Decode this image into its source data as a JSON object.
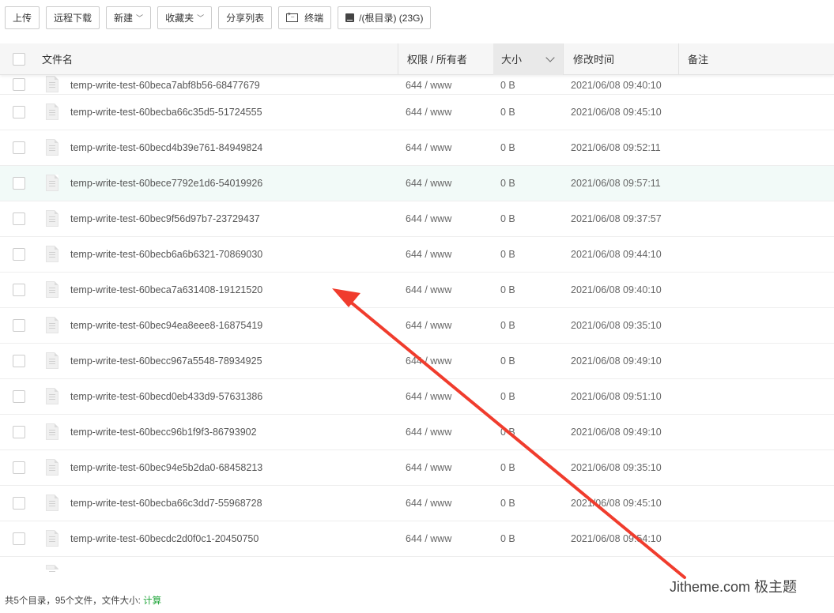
{
  "toolbar": {
    "upload": "上传",
    "remote_download": "远程下载",
    "new": "新建",
    "favorites": "收藏夹",
    "share_list": "分享列表",
    "terminal": "终端",
    "disk": "/(根目录) (23G)"
  },
  "table": {
    "headers": {
      "name": "文件名",
      "perm": "权限 / 所有者",
      "size": "大小",
      "mtime": "修改时间",
      "note": "备注"
    },
    "partial_row": {
      "name": "temp-write-test-60beca7abf8b56-68477679",
      "perm": "644 / www",
      "size": "0 B",
      "mtime": "2021/06/08 09:40:10"
    },
    "rows": [
      {
        "name": "temp-write-test-60becba66c35d5-51724555",
        "perm": "644 / www",
        "size": "0 B",
        "mtime": "2021/06/08 09:45:10"
      },
      {
        "name": "temp-write-test-60becd4b39e761-84949824",
        "perm": "644 / www",
        "size": "0 B",
        "mtime": "2021/06/08 09:52:11"
      },
      {
        "name": "temp-write-test-60bece7792e1d6-54019926",
        "perm": "644 / www",
        "size": "0 B",
        "mtime": "2021/06/08 09:57:11"
      },
      {
        "name": "temp-write-test-60bec9f56d97b7-23729437",
        "perm": "644 / www",
        "size": "0 B",
        "mtime": "2021/06/08 09:37:57"
      },
      {
        "name": "temp-write-test-60becb6a6b6321-70869030",
        "perm": "644 / www",
        "size": "0 B",
        "mtime": "2021/06/08 09:44:10"
      },
      {
        "name": "temp-write-test-60beca7a631408-19121520",
        "perm": "644 / www",
        "size": "0 B",
        "mtime": "2021/06/08 09:40:10"
      },
      {
        "name": "temp-write-test-60bec94ea8eee8-16875419",
        "perm": "644 / www",
        "size": "0 B",
        "mtime": "2021/06/08 09:35:10"
      },
      {
        "name": "temp-write-test-60becc967a5548-78934925",
        "perm": "644 / www",
        "size": "0 B",
        "mtime": "2021/06/08 09:49:10"
      },
      {
        "name": "temp-write-test-60becd0eb433d9-57631386",
        "perm": "644 / www",
        "size": "0 B",
        "mtime": "2021/06/08 09:51:10"
      },
      {
        "name": "temp-write-test-60becc96b1f9f3-86793902",
        "perm": "644 / www",
        "size": "0 B",
        "mtime": "2021/06/08 09:49:10"
      },
      {
        "name": "temp-write-test-60bec94e5b2da0-68458213",
        "perm": "644 / www",
        "size": "0 B",
        "mtime": "2021/06/08 09:35:10"
      },
      {
        "name": "temp-write-test-60becba66c3dd7-55968728",
        "perm": "644 / www",
        "size": "0 B",
        "mtime": "2021/06/08 09:45:10"
      },
      {
        "name": "temp-write-test-60becdc2d0f0c1-20450750",
        "perm": "644 / www",
        "size": "0 B",
        "mtime": "2021/06/08 09:54:10"
      }
    ]
  },
  "footer": {
    "summary": "共5个目录，95个文件，文件大小:",
    "calc_link": "计算"
  },
  "watermark": "Jitheme.com 极主题",
  "colors": {
    "accent": "#20a53a",
    "hover_row": "#f2faf8",
    "annotation_arrow": "#f03c2d"
  }
}
